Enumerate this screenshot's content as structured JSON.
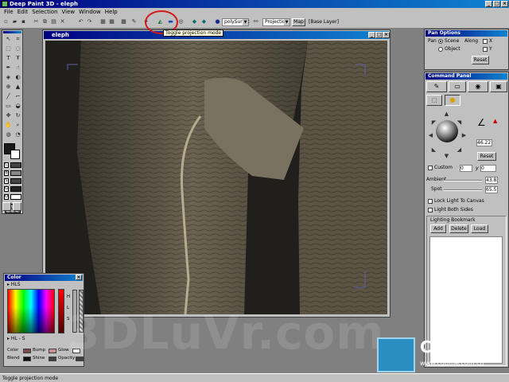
{
  "app": {
    "title": "Deep Paint 3D - eleph"
  },
  "menu": [
    "File",
    "Edit",
    "Selection",
    "View",
    "Window",
    "Help"
  ],
  "toolbar": {
    "mesh_select": "polySurfac",
    "mode_select": "Projection",
    "map_button": "Map",
    "layer_label": "[Base Layer]",
    "tooltip": "Toggle projection mode"
  },
  "viewport": {
    "title": "eleph"
  },
  "color_panel": {
    "title": "Color",
    "mode": "HLS",
    "channels": [
      "H",
      "L",
      "S"
    ],
    "mode_footer": "HL - S",
    "swatches": [
      {
        "label": "Color",
        "color": "#7a4a4a"
      },
      {
        "label": "Bump",
        "color": "#c89090"
      },
      {
        "label": "Glow",
        "color": "#404040"
      },
      {
        "label": "",
        "color": "#ffffff"
      },
      {
        "label": "Blend",
        "color": "#101010"
      },
      {
        "label": "Shine",
        "color": "#404040"
      },
      {
        "label": "Opacity",
        "color": "#404040"
      }
    ]
  },
  "pan_options": {
    "title": "Pan Options",
    "pan_label": "Pan",
    "scene": "Scene",
    "object": "Object",
    "along": "Along",
    "x": "X",
    "y": "Y",
    "reset": "Reset"
  },
  "command_panel": {
    "title": "Command Panel",
    "angle_value": "46.22",
    "reset": "Reset",
    "custom_label": "Custom",
    "x_value": "0",
    "y_label": "y",
    "y_value": "0",
    "ambient_label": "Ambient",
    "ambient_value": "43.8",
    "spot_label": "Spot",
    "spot_value": "65.5",
    "lock_light": "Lock Light To Canvas",
    "light_both": "Light Both Sides",
    "bookmark_title": "Lighting Bookmark",
    "add": "Add",
    "delete": "Delete",
    "load": "Load"
  },
  "status": {
    "text": "Toggle projection mode"
  },
  "watermark": {
    "text": "3DLuVr.com"
  },
  "logo": {
    "text": "CG时代",
    "url": "www.cgtime.com.cn"
  },
  "colors": {
    "titlebar": "#000080",
    "highlight": "#d21a1a",
    "face": "#c0c0c0"
  }
}
